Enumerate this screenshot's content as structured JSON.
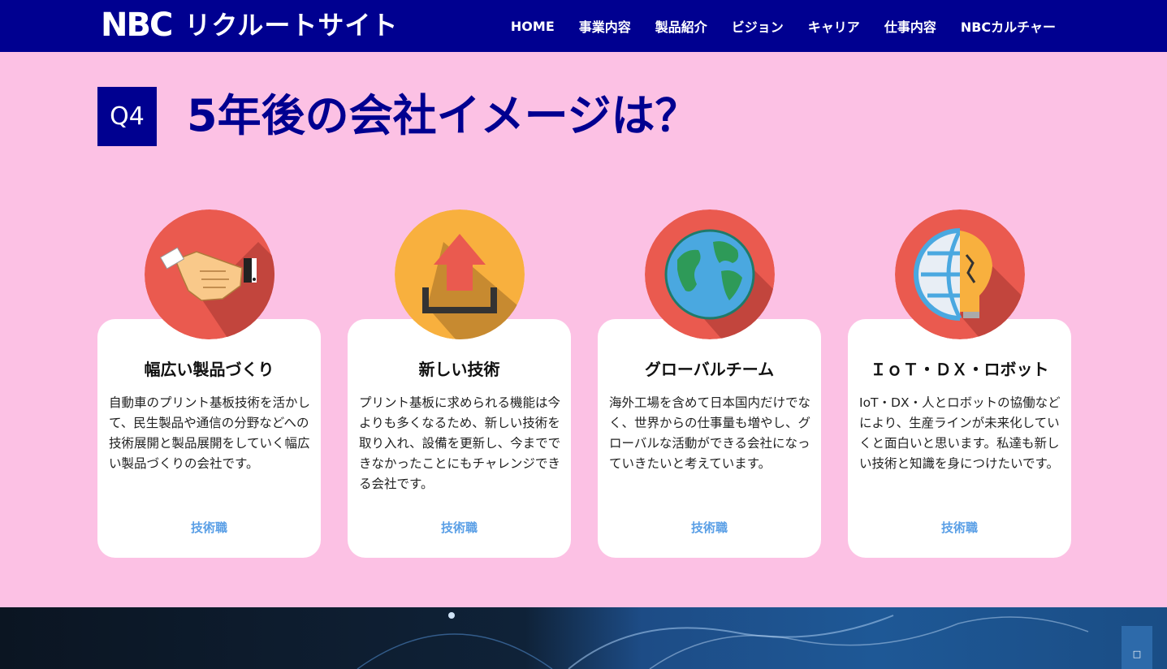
{
  "header": {
    "logo_mark": "NBC",
    "logo_text": "リクルートサイト",
    "nav": [
      "HOME",
      "事業内容",
      "製品紹介",
      "ビジョン",
      "キャリア",
      "仕事内容",
      "NBCカルチャー"
    ]
  },
  "section": {
    "q_label": "Q4",
    "title": "5年後の会社イメージは？"
  },
  "cards": [
    {
      "title": "幅広い製品づくり",
      "body": "自動車のプリント基板技術を活かして、民生製品や通信の分野などへの技術展開と製品展開をしていく幅広い製品づくりの会社です。",
      "tag": "技術職",
      "icon": "handshake-icon"
    },
    {
      "title": "新しい技術",
      "body": "プリント基板に求められる機能は今よりも多くなるため、新しい技術を取り入れ、設備を更新し、今までできなかったことにもチャレンジできる会社です。",
      "tag": "技術職",
      "icon": "upload-arrow-icon"
    },
    {
      "title": "グローバルチーム",
      "body": "海外工場を含めて日本国内だけでなく、世界からの仕事量も増やし、グローバルな活動ができる会社になっていきたいと考えています。",
      "tag": "技術職",
      "icon": "globe-icon"
    },
    {
      "title": "ＩｏＴ・ＤＸ・ロボット",
      "body": "IoT・DX・人とロボットの協働などにより、生産ラインが未来化していくと面白いと思います。私達も新しい技術と知識を身につけたいです。",
      "tag": "技術職",
      "icon": "globe-lightbulb-icon"
    }
  ],
  "colors": {
    "navy": "#000090",
    "pink_bg": "#fcc1e4",
    "tag_blue": "#5a9fe6",
    "icon_red": "#ea5a4f",
    "icon_orange": "#f8b03e"
  },
  "scroll_top_icon": "scroll-to-top-icon",
  "scroll_top_glyph": "□"
}
